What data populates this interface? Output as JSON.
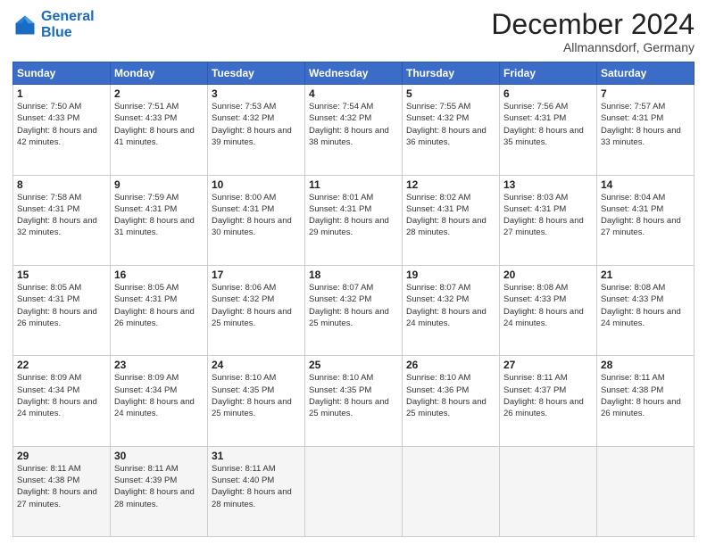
{
  "header": {
    "logo_line1": "General",
    "logo_line2": "Blue",
    "month_title": "December 2024",
    "location": "Allmannsdorf, Germany"
  },
  "days_of_week": [
    "Sunday",
    "Monday",
    "Tuesday",
    "Wednesday",
    "Thursday",
    "Friday",
    "Saturday"
  ],
  "weeks": [
    [
      {
        "num": "1",
        "sunrise": "7:50 AM",
        "sunset": "4:33 PM",
        "daylight": "8 hours and 42 minutes."
      },
      {
        "num": "2",
        "sunrise": "7:51 AM",
        "sunset": "4:33 PM",
        "daylight": "8 hours and 41 minutes."
      },
      {
        "num": "3",
        "sunrise": "7:53 AM",
        "sunset": "4:32 PM",
        "daylight": "8 hours and 39 minutes."
      },
      {
        "num": "4",
        "sunrise": "7:54 AM",
        "sunset": "4:32 PM",
        "daylight": "8 hours and 38 minutes."
      },
      {
        "num": "5",
        "sunrise": "7:55 AM",
        "sunset": "4:32 PM",
        "daylight": "8 hours and 36 minutes."
      },
      {
        "num": "6",
        "sunrise": "7:56 AM",
        "sunset": "4:31 PM",
        "daylight": "8 hours and 35 minutes."
      },
      {
        "num": "7",
        "sunrise": "7:57 AM",
        "sunset": "4:31 PM",
        "daylight": "8 hours and 33 minutes."
      }
    ],
    [
      {
        "num": "8",
        "sunrise": "7:58 AM",
        "sunset": "4:31 PM",
        "daylight": "8 hours and 32 minutes."
      },
      {
        "num": "9",
        "sunrise": "7:59 AM",
        "sunset": "4:31 PM",
        "daylight": "8 hours and 31 minutes."
      },
      {
        "num": "10",
        "sunrise": "8:00 AM",
        "sunset": "4:31 PM",
        "daylight": "8 hours and 30 minutes."
      },
      {
        "num": "11",
        "sunrise": "8:01 AM",
        "sunset": "4:31 PM",
        "daylight": "8 hours and 29 minutes."
      },
      {
        "num": "12",
        "sunrise": "8:02 AM",
        "sunset": "4:31 PM",
        "daylight": "8 hours and 28 minutes."
      },
      {
        "num": "13",
        "sunrise": "8:03 AM",
        "sunset": "4:31 PM",
        "daylight": "8 hours and 27 minutes."
      },
      {
        "num": "14",
        "sunrise": "8:04 AM",
        "sunset": "4:31 PM",
        "daylight": "8 hours and 27 minutes."
      }
    ],
    [
      {
        "num": "15",
        "sunrise": "8:05 AM",
        "sunset": "4:31 PM",
        "daylight": "8 hours and 26 minutes."
      },
      {
        "num": "16",
        "sunrise": "8:05 AM",
        "sunset": "4:31 PM",
        "daylight": "8 hours and 26 minutes."
      },
      {
        "num": "17",
        "sunrise": "8:06 AM",
        "sunset": "4:32 PM",
        "daylight": "8 hours and 25 minutes."
      },
      {
        "num": "18",
        "sunrise": "8:07 AM",
        "sunset": "4:32 PM",
        "daylight": "8 hours and 25 minutes."
      },
      {
        "num": "19",
        "sunrise": "8:07 AM",
        "sunset": "4:32 PM",
        "daylight": "8 hours and 24 minutes."
      },
      {
        "num": "20",
        "sunrise": "8:08 AM",
        "sunset": "4:33 PM",
        "daylight": "8 hours and 24 minutes."
      },
      {
        "num": "21",
        "sunrise": "8:08 AM",
        "sunset": "4:33 PM",
        "daylight": "8 hours and 24 minutes."
      }
    ],
    [
      {
        "num": "22",
        "sunrise": "8:09 AM",
        "sunset": "4:34 PM",
        "daylight": "8 hours and 24 minutes."
      },
      {
        "num": "23",
        "sunrise": "8:09 AM",
        "sunset": "4:34 PM",
        "daylight": "8 hours and 24 minutes."
      },
      {
        "num": "24",
        "sunrise": "8:10 AM",
        "sunset": "4:35 PM",
        "daylight": "8 hours and 25 minutes."
      },
      {
        "num": "25",
        "sunrise": "8:10 AM",
        "sunset": "4:35 PM",
        "daylight": "8 hours and 25 minutes."
      },
      {
        "num": "26",
        "sunrise": "8:10 AM",
        "sunset": "4:36 PM",
        "daylight": "8 hours and 25 minutes."
      },
      {
        "num": "27",
        "sunrise": "8:11 AM",
        "sunset": "4:37 PM",
        "daylight": "8 hours and 26 minutes."
      },
      {
        "num": "28",
        "sunrise": "8:11 AM",
        "sunset": "4:38 PM",
        "daylight": "8 hours and 26 minutes."
      }
    ],
    [
      {
        "num": "29",
        "sunrise": "8:11 AM",
        "sunset": "4:38 PM",
        "daylight": "8 hours and 27 minutes."
      },
      {
        "num": "30",
        "sunrise": "8:11 AM",
        "sunset": "4:39 PM",
        "daylight": "8 hours and 28 minutes."
      },
      {
        "num": "31",
        "sunrise": "8:11 AM",
        "sunset": "4:40 PM",
        "daylight": "8 hours and 28 minutes."
      },
      null,
      null,
      null,
      null
    ]
  ]
}
